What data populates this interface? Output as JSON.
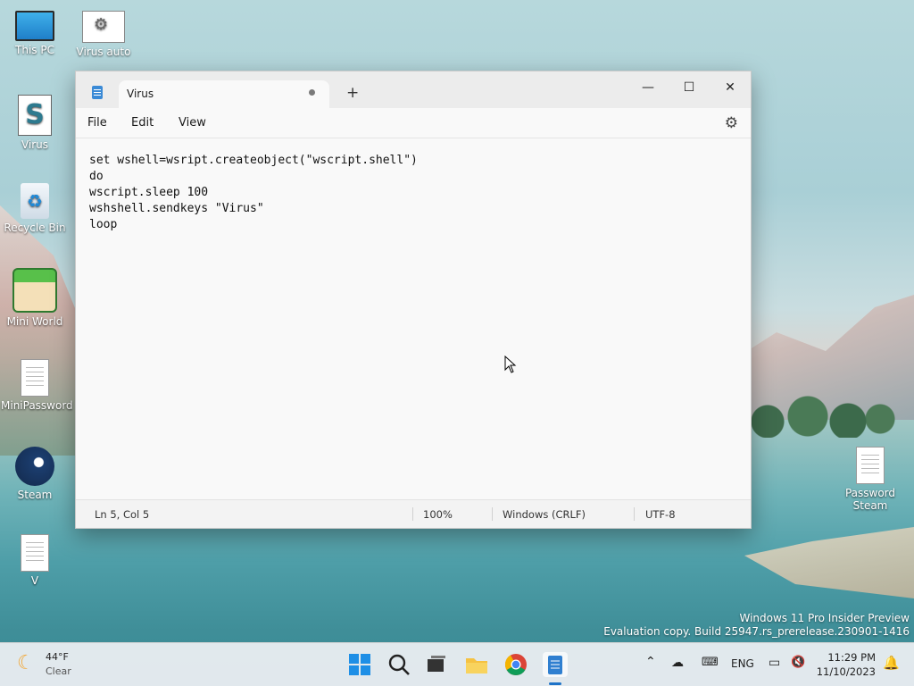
{
  "desktop": {
    "icons": [
      {
        "label": "This PC"
      },
      {
        "label": "Virus auto"
      },
      {
        "label": "Virus"
      },
      {
        "label": "Recycle Bin"
      },
      {
        "label": "Mini World"
      },
      {
        "label": "MiniPassword"
      },
      {
        "label": "Steam"
      },
      {
        "label": "V"
      },
      {
        "label": "Password Steam"
      }
    ],
    "watermark": {
      "line1": "Windows 11 Pro Insider Preview",
      "line2": "Evaluation copy. Build 25947.rs_prerelease.230901-1416"
    }
  },
  "notepad": {
    "tab_title": "Virus",
    "new_tab": "+",
    "controls": {
      "minimize": "—",
      "maximize": "☐",
      "close": "✕"
    },
    "menu": {
      "file": "File",
      "edit": "Edit",
      "view": "View"
    },
    "settings_icon": "gear-icon",
    "content_lines": [
      "set wshell=wsript.createobject(\"wscript.shell\")",
      "do",
      "wscript.sleep 100",
      "wshshell.sendkeys \"Virus\"",
      "loop"
    ],
    "status": {
      "position": "Ln 5, Col 5",
      "zoom": "100%",
      "line_ending": "Windows (CRLF)",
      "encoding": "UTF-8"
    }
  },
  "taskbar": {
    "weather": {
      "temp": "44°F",
      "condition": "Clear"
    },
    "tray": {
      "language": "ENG"
    },
    "clock": {
      "time": "11:29 PM",
      "date": "11/10/2023"
    }
  }
}
